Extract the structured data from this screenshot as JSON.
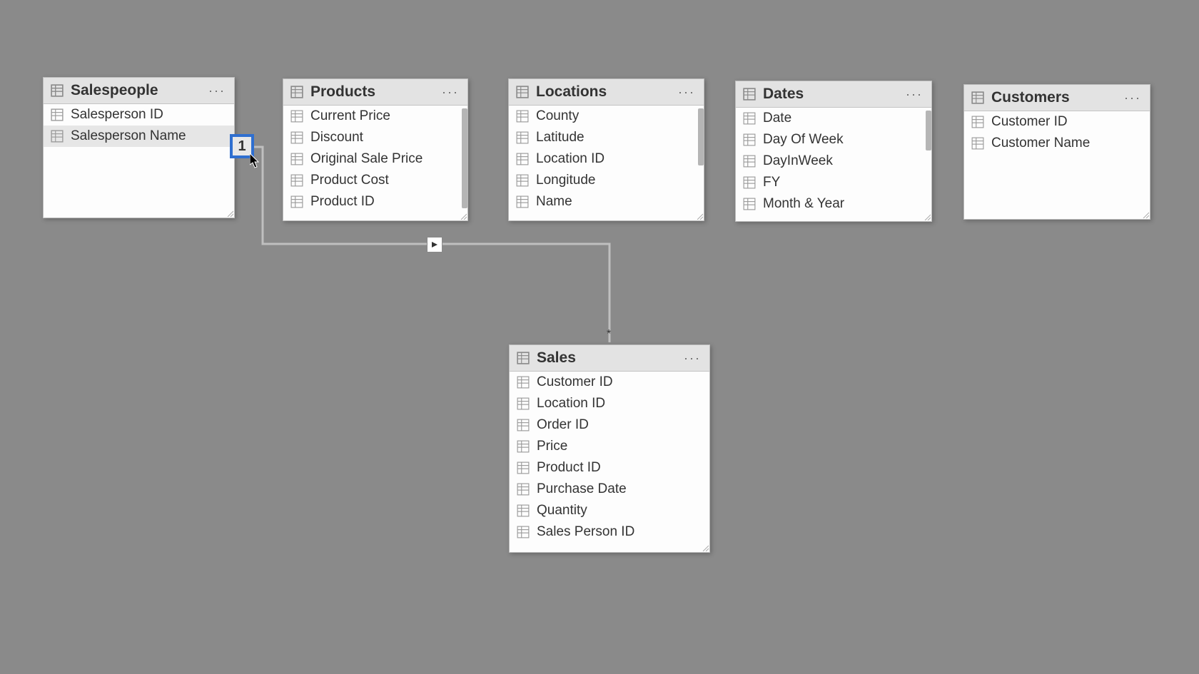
{
  "tables": {
    "salespeople": {
      "title": "Salespeople",
      "fields": [
        "Salesperson ID",
        "Salesperson Name"
      ]
    },
    "products": {
      "title": "Products",
      "fields": [
        "Current Price",
        "Discount",
        "Original Sale Price",
        "Product Cost",
        "Product ID"
      ]
    },
    "locations": {
      "title": "Locations",
      "fields": [
        "County",
        "Latitude",
        "Location ID",
        "Longitude",
        "Name"
      ]
    },
    "dates": {
      "title": "Dates",
      "fields": [
        "Date",
        "Day Of Week",
        "DayInWeek",
        "FY",
        "Month & Year"
      ]
    },
    "customers": {
      "title": "Customers",
      "fields": [
        "Customer ID",
        "Customer Name"
      ]
    },
    "sales": {
      "title": "Sales",
      "fields": [
        "Customer ID",
        "Location ID",
        "Order ID",
        "Price",
        "Product ID",
        "Purchase Date",
        "Quantity",
        "Sales Person ID"
      ]
    }
  },
  "relationship": {
    "cardinality_one": "1",
    "cardinality_many": "*"
  }
}
